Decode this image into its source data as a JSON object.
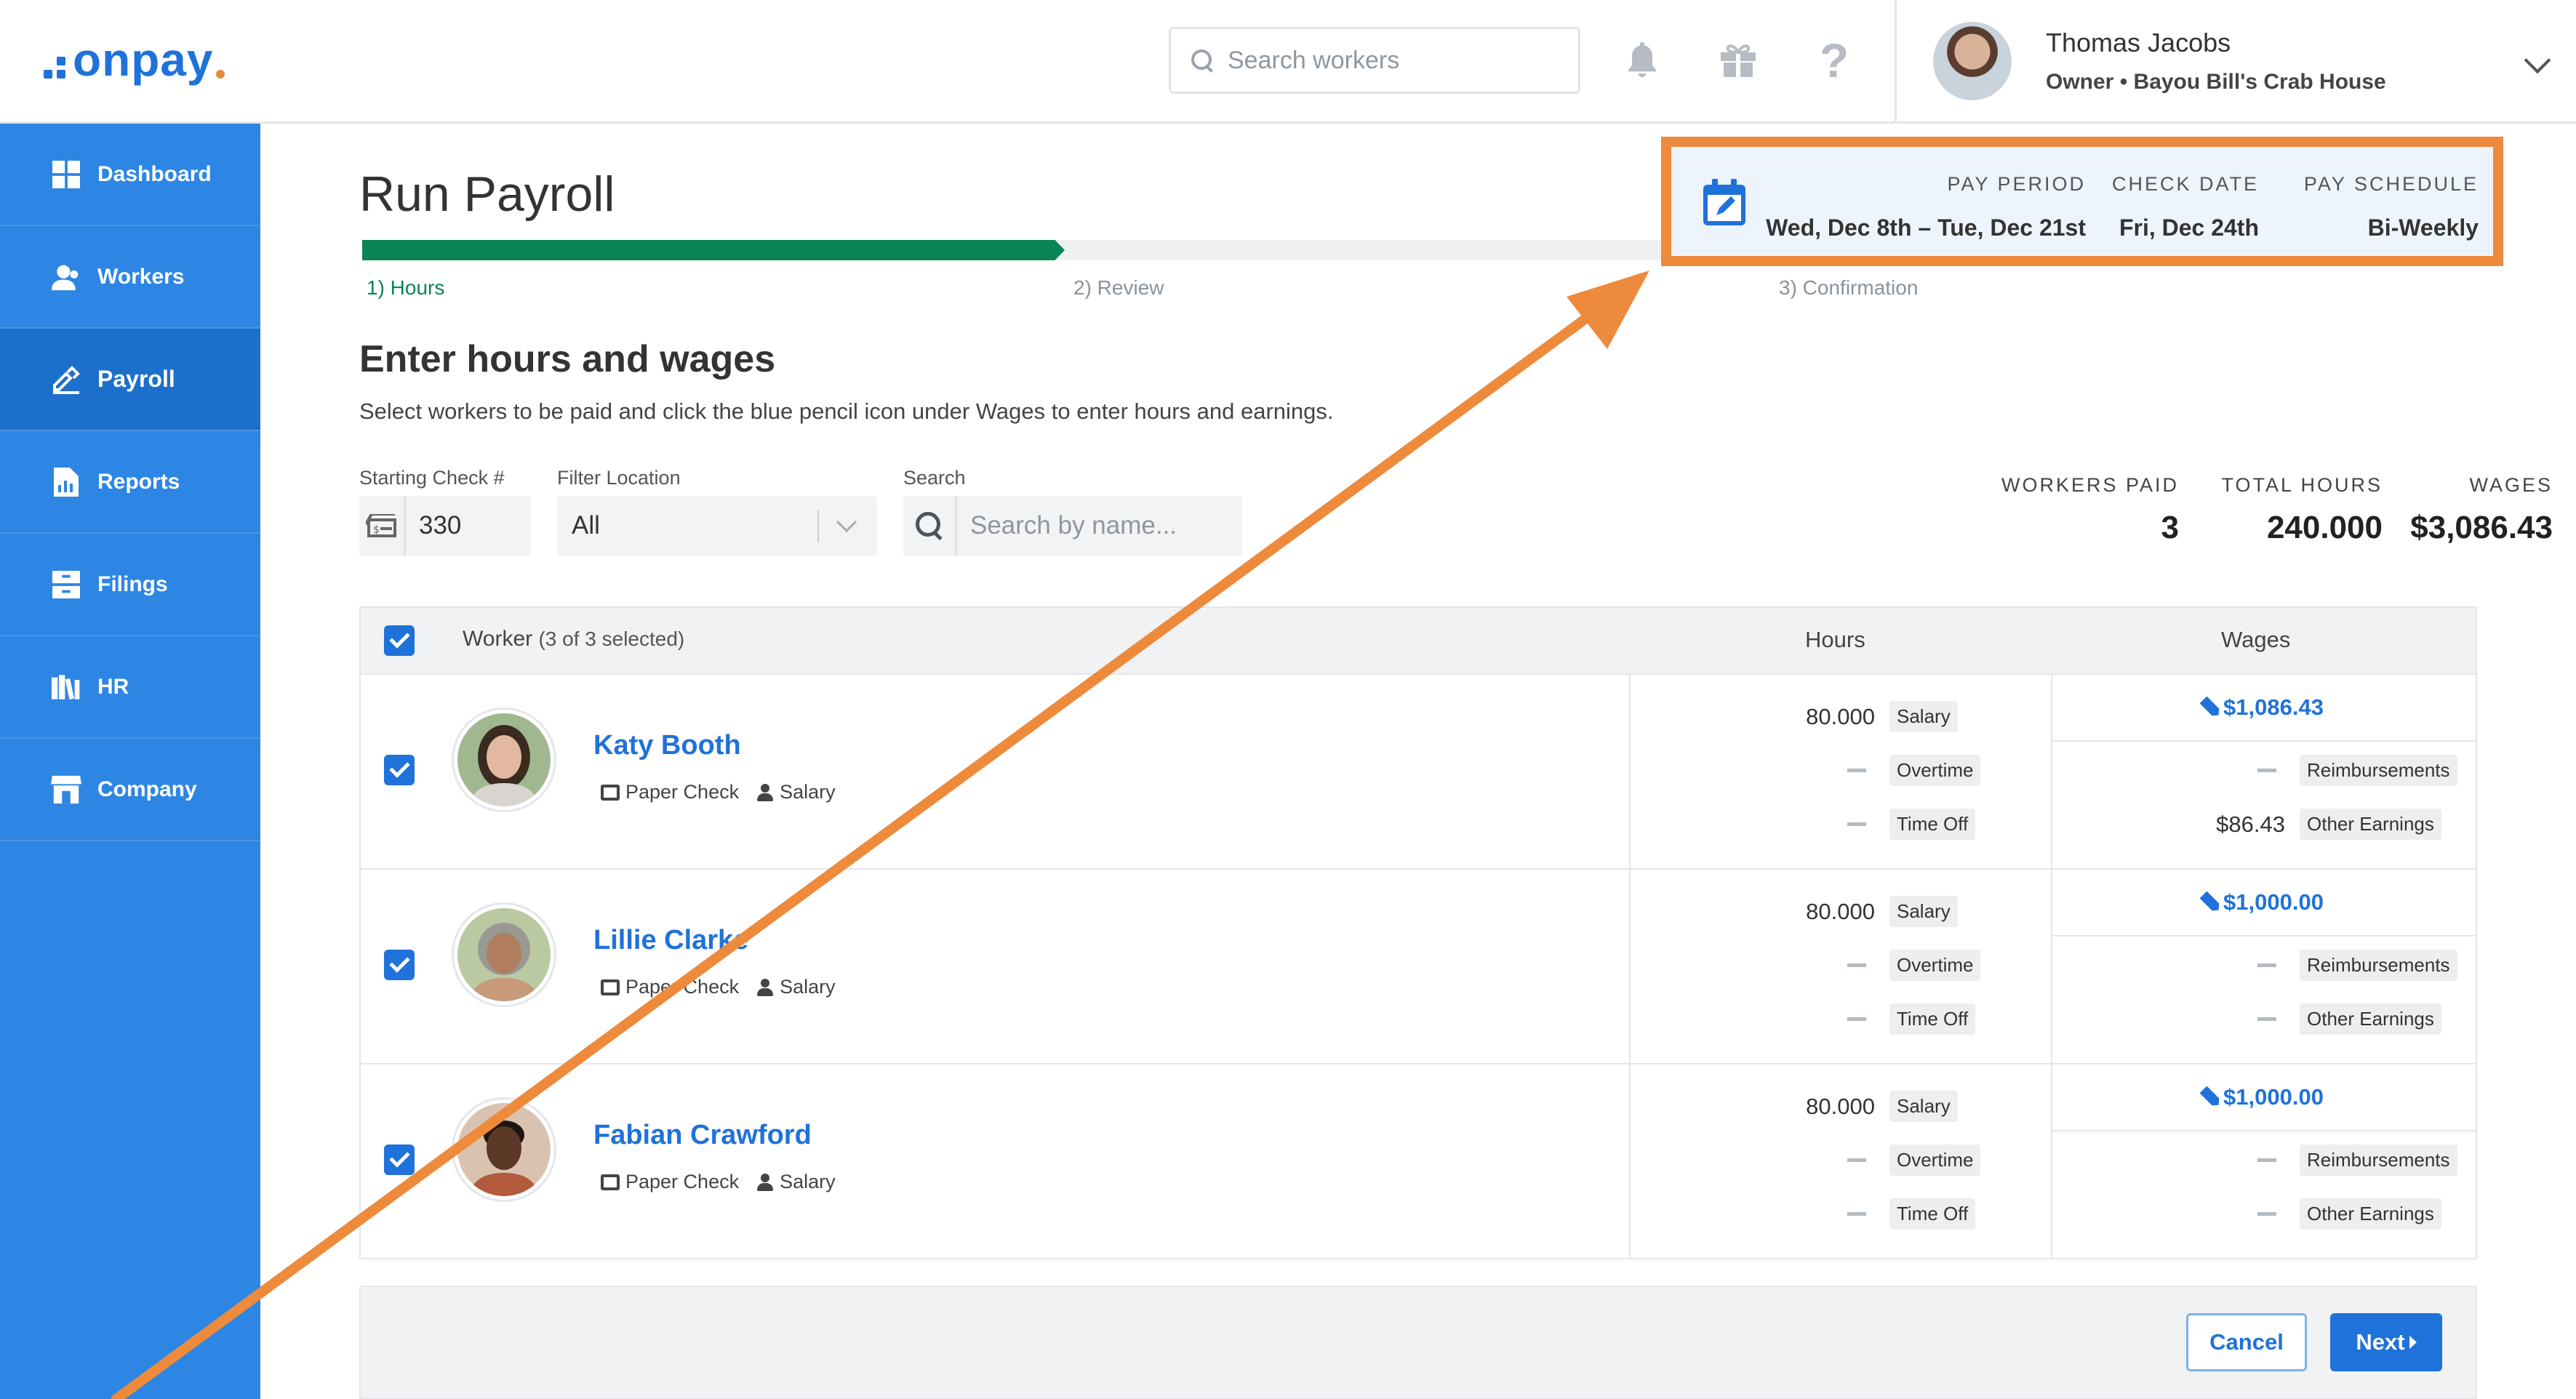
{
  "brand": {
    "name": "onpay",
    "color": "#1f72d9",
    "accent": "#e58a3a"
  },
  "header": {
    "search_placeholder": "Search workers",
    "user_name": "Thomas Jacobs",
    "user_role": "Owner • Bayou Bill's Crab House",
    "help_glyph": "?"
  },
  "sidebar": {
    "items": [
      {
        "label": "Dashboard",
        "icon": "dashboard-icon"
      },
      {
        "label": "Workers",
        "icon": "workers-icon"
      },
      {
        "label": "Payroll",
        "icon": "payroll-icon",
        "active": true
      },
      {
        "label": "Reports",
        "icon": "reports-icon"
      },
      {
        "label": "Filings",
        "icon": "filings-icon"
      },
      {
        "label": "HR",
        "icon": "hr-icon"
      },
      {
        "label": "Company",
        "icon": "company-icon"
      }
    ]
  },
  "page": {
    "title": "Run Payroll",
    "steps": [
      "1) Hours",
      "2) Review",
      "3) Confirmation"
    ],
    "progress_fraction": 0.33,
    "section_title": "Enter hours and wages",
    "section_desc": "Select workers to be paid and click the blue pencil icon under Wages to enter hours and earnings."
  },
  "pay_info": {
    "period_label": "PAY PERIOD",
    "period_value": "Wed, Dec 8th – Tue, Dec 21st",
    "check_label": "CHECK DATE",
    "check_value": "Fri, Dec 24th",
    "schedule_label": "PAY SCHEDULE",
    "schedule_value": "Bi-Weekly",
    "highlight_color": "#ee8a3c"
  },
  "filters": {
    "check_label": "Starting Check #",
    "check_value": "330",
    "location_label": "Filter Location",
    "location_value": "All",
    "search_label": "Search",
    "search_placeholder": "Search by name..."
  },
  "summary": {
    "workers_label": "WORKERS PAID",
    "workers_value": "3",
    "hours_label": "TOTAL HOURS",
    "hours_value": "240.000",
    "wages_label": "WAGES",
    "wages_value": "$3,086.43"
  },
  "table": {
    "col_worker": "Worker",
    "selected_count": "(3 of 3 selected)",
    "col_hours": "Hours",
    "col_wages": "Wages",
    "rows": [
      {
        "name": "Katy Booth",
        "pay_method": "Paper Check",
        "pay_type": "Salary",
        "salary_hours": "80.000",
        "salary_label": "Salary",
        "overtime_label": "Overtime",
        "timeoff_label": "Time Off",
        "wage": "$1,086.43",
        "reimb_label": "Reimbursements",
        "other_value": "$86.43",
        "other_label": "Other Earnings"
      },
      {
        "name": "Lillie Clarke",
        "pay_method": "Paper Check",
        "pay_type": "Salary",
        "salary_hours": "80.000",
        "salary_label": "Salary",
        "overtime_label": "Overtime",
        "timeoff_label": "Time Off",
        "wage": "$1,000.00",
        "reimb_label": "Reimbursements",
        "other_value": "",
        "other_label": "Other Earnings"
      },
      {
        "name": "Fabian Crawford",
        "pay_method": "Paper Check",
        "pay_type": "Salary",
        "salary_hours": "80.000",
        "salary_label": "Salary",
        "overtime_label": "Overtime",
        "timeoff_label": "Time Off",
        "wage": "$1,000.00",
        "reimb_label": "Reimbursements",
        "other_value": "",
        "other_label": "Other Earnings"
      }
    ]
  },
  "footer": {
    "cancel_label": "Cancel",
    "next_label": "Next"
  }
}
